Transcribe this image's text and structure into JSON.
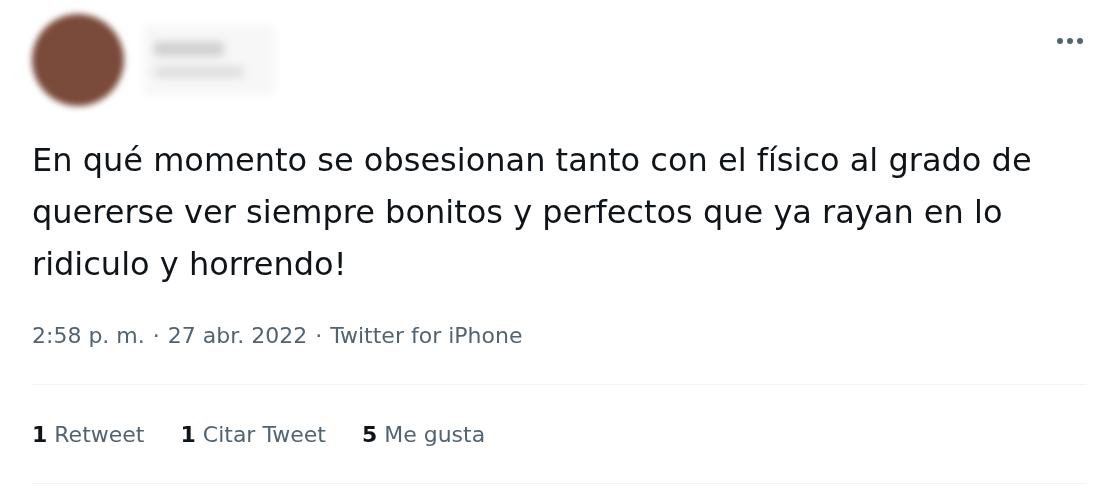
{
  "tweet": {
    "text": "En qué momento se obsesionan tanto con el físico al grado de quererse ver siempre bonitos y perfectos que ya rayan en lo ridiculo y horrendo!",
    "meta": [
      "2:58 p. m.",
      "·",
      "27 abr. 2022",
      "·",
      "Twitter for iPhone"
    ],
    "stats": [
      {
        "count": "1",
        "label": "Retweet"
      },
      {
        "count": "1",
        "label": "Citar Tweet"
      },
      {
        "count": "5",
        "label": "Me gusta"
      }
    ]
  }
}
